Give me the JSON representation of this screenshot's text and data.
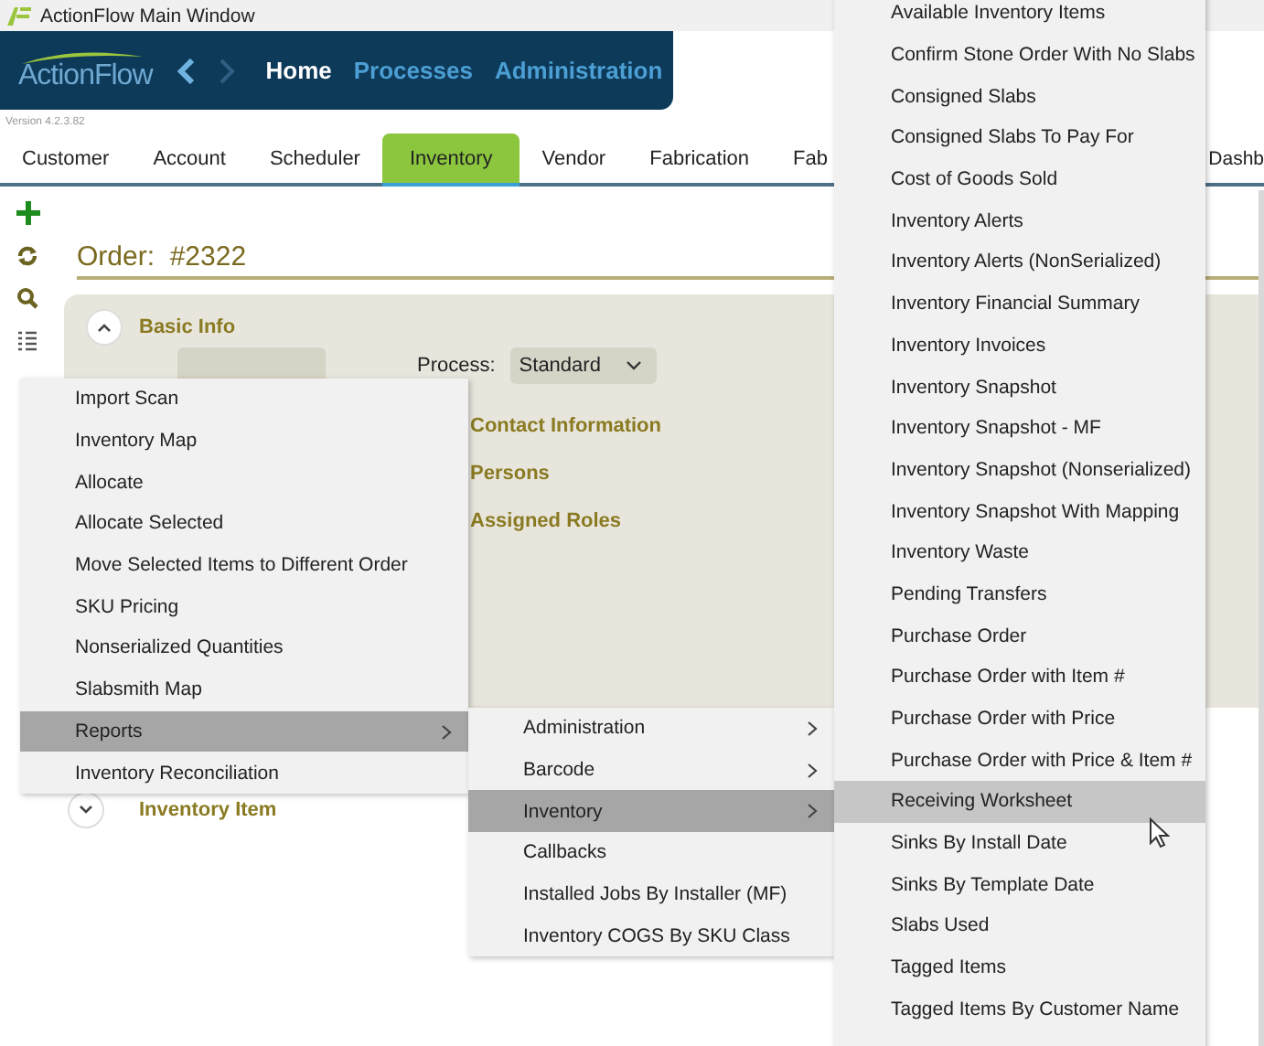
{
  "window": {
    "title": "ActionFlow Main Window"
  },
  "header": {
    "logo": "ActionFlow",
    "nav": [
      {
        "label": "Home",
        "selected": true
      },
      {
        "label": "Processes",
        "selected": false
      },
      {
        "label": "Administration",
        "selected": false
      }
    ],
    "version": "Version 4.2.3.82"
  },
  "tabs": [
    {
      "label": "Customer",
      "selected": false
    },
    {
      "label": "Account",
      "selected": false
    },
    {
      "label": "Scheduler",
      "selected": false
    },
    {
      "label": "Inventory",
      "selected": true
    },
    {
      "label": "Vendor",
      "selected": false
    },
    {
      "label": "Fabrication",
      "selected": false
    },
    {
      "label": "Fab",
      "selected": false
    },
    {
      "label": "Dashb",
      "selected": false
    }
  ],
  "order": {
    "label": "Order:",
    "number": "#2322"
  },
  "basic_info": {
    "title": "Basic Info",
    "expanded": true,
    "process_label": "Process:",
    "process_value": "Standard",
    "sections": [
      "Contact Information",
      "Persons",
      "Assigned Roles"
    ]
  },
  "inventory_item": {
    "title": "Inventory Item",
    "expanded": false
  },
  "menus": [
    {
      "items": [
        {
          "label": "Import Scan",
          "selected": false,
          "submenu": false
        },
        {
          "label": "Inventory Map",
          "selected": false,
          "submenu": false
        },
        {
          "label": "Allocate",
          "selected": false,
          "submenu": false
        },
        {
          "label": "Allocate Selected",
          "selected": false,
          "submenu": false
        },
        {
          "label": "Move Selected Items to Different Order",
          "selected": false,
          "submenu": false
        },
        {
          "label": "SKU Pricing",
          "selected": false,
          "submenu": false
        },
        {
          "label": "Nonserialized Quantities",
          "selected": false,
          "submenu": false
        },
        {
          "label": "Slabsmith Map",
          "selected": false,
          "submenu": false
        },
        {
          "label": "Reports",
          "selected": true,
          "submenu": true
        },
        {
          "label": "Inventory Reconciliation",
          "selected": false,
          "submenu": false
        }
      ]
    },
    {
      "items": [
        {
          "label": "Administration",
          "selected": false,
          "submenu": true
        },
        {
          "label": "Barcode",
          "selected": false,
          "submenu": true
        },
        {
          "label": "Inventory",
          "selected": true,
          "submenu": true
        },
        {
          "label": "Callbacks",
          "selected": false,
          "submenu": false
        },
        {
          "label": "Installed Jobs By Installer (MF)",
          "selected": false,
          "submenu": false
        },
        {
          "label": "Inventory COGS By SKU Class",
          "selected": false,
          "submenu": false
        }
      ]
    },
    {
      "items": [
        {
          "label": "Available Inventory Items",
          "selected": false,
          "submenu": false
        },
        {
          "label": "Confirm Stone Order With No Slabs",
          "selected": false,
          "submenu": false
        },
        {
          "label": "Consigned Slabs",
          "selected": false,
          "submenu": false
        },
        {
          "label": "Consigned Slabs To Pay For",
          "selected": false,
          "submenu": false
        },
        {
          "label": "Cost of Goods Sold",
          "selected": false,
          "submenu": false
        },
        {
          "label": "Inventory Alerts",
          "selected": false,
          "submenu": false
        },
        {
          "label": "Inventory Alerts (NonSerialized)",
          "selected": false,
          "submenu": false
        },
        {
          "label": "Inventory Financial Summary",
          "selected": false,
          "submenu": false
        },
        {
          "label": "Inventory Invoices",
          "selected": false,
          "submenu": false
        },
        {
          "label": "Inventory Snapshot",
          "selected": false,
          "submenu": false
        },
        {
          "label": "Inventory Snapshot - MF",
          "selected": false,
          "submenu": false
        },
        {
          "label": "Inventory Snapshot (Nonserialized)",
          "selected": false,
          "submenu": false
        },
        {
          "label": "Inventory Snapshot With Mapping",
          "selected": false,
          "submenu": false
        },
        {
          "label": "Inventory Waste",
          "selected": false,
          "submenu": false
        },
        {
          "label": "Pending Transfers",
          "selected": false,
          "submenu": false
        },
        {
          "label": "Purchase Order",
          "selected": false,
          "submenu": false
        },
        {
          "label": "Purchase Order with Item #",
          "selected": false,
          "submenu": false
        },
        {
          "label": "Purchase Order with Price",
          "selected": false,
          "submenu": false
        },
        {
          "label": "Purchase Order with Price & Item #",
          "selected": false,
          "submenu": false
        },
        {
          "label": "Receiving Worksheet",
          "selected": true,
          "submenu": false
        },
        {
          "label": "Sinks By Install Date",
          "selected": false,
          "submenu": false
        },
        {
          "label": "Sinks By Template Date",
          "selected": false,
          "submenu": false
        },
        {
          "label": "Slabs Used",
          "selected": false,
          "submenu": false
        },
        {
          "label": "Tagged Items",
          "selected": false,
          "submenu": false
        },
        {
          "label": "Tagged Items By Customer Name",
          "selected": false,
          "submenu": false
        }
      ]
    }
  ]
}
